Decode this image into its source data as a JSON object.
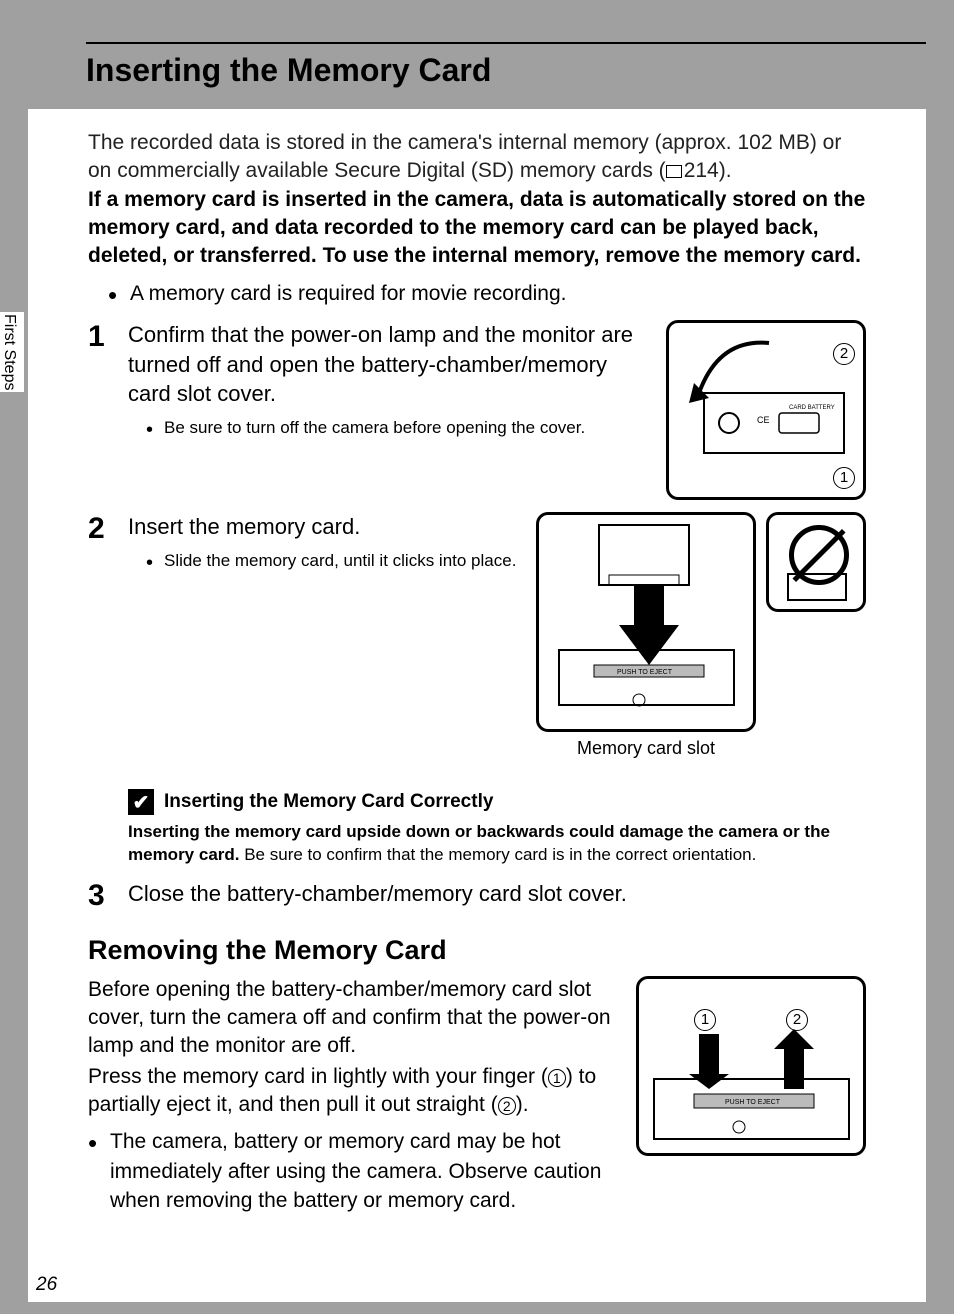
{
  "sideLabel": "First Steps",
  "pageNumber": "26",
  "title": "Inserting the Memory Card",
  "intro": "The recorded data is stored in the camera's internal memory (approx. 102 MB) or on commercially available Secure Digital (SD) memory cards (",
  "introRef": "214).",
  "introBold": "If a memory card is inserted in the camera, data is automatically stored on the memory card, and data recorded to the memory card can be played back, deleted, or transferred. To use the internal memory, remove the memory card.",
  "introBullet": "A memory card is required for movie recording.",
  "step1": {
    "num": "1",
    "title": "Confirm that the power-on lamp and the monitor are turned off and open the battery-chamber/memory card slot cover.",
    "sub": "Be sure to turn off the camera before opening the cover."
  },
  "step2": {
    "num": "2",
    "title": "Insert the memory card.",
    "sub": "Slide the memory card, until it clicks into place.",
    "caption": "Memory card slot"
  },
  "note": {
    "title": "Inserting the Memory Card Correctly",
    "boldText": "Inserting the memory card upside down or backwards could damage the camera or the memory card.",
    "restText": " Be sure to confirm that the memory card is in the correct orientation."
  },
  "step3": {
    "num": "3",
    "title": "Close the battery-chamber/memory card slot cover."
  },
  "removing": {
    "heading": "Removing the Memory Card",
    "p1": "Before opening the battery-chamber/memory card slot cover, turn the camera off and confirm that the power-on lamp and the monitor are off.",
    "p2a": "Press the memory card in lightly with your finger (",
    "p2b": ") to partially eject it, and then pull it out straight (",
    "p2c": ").",
    "bullet": "The camera, battery or memory card may be hot immediately after using the camera. Observe caution when removing the battery or memory card."
  },
  "callouts": {
    "c1": "1",
    "c2": "2"
  },
  "figText": {
    "pushToEject": "PUSH TO EJECT",
    "cardBattery": "CARD BATTERY"
  }
}
